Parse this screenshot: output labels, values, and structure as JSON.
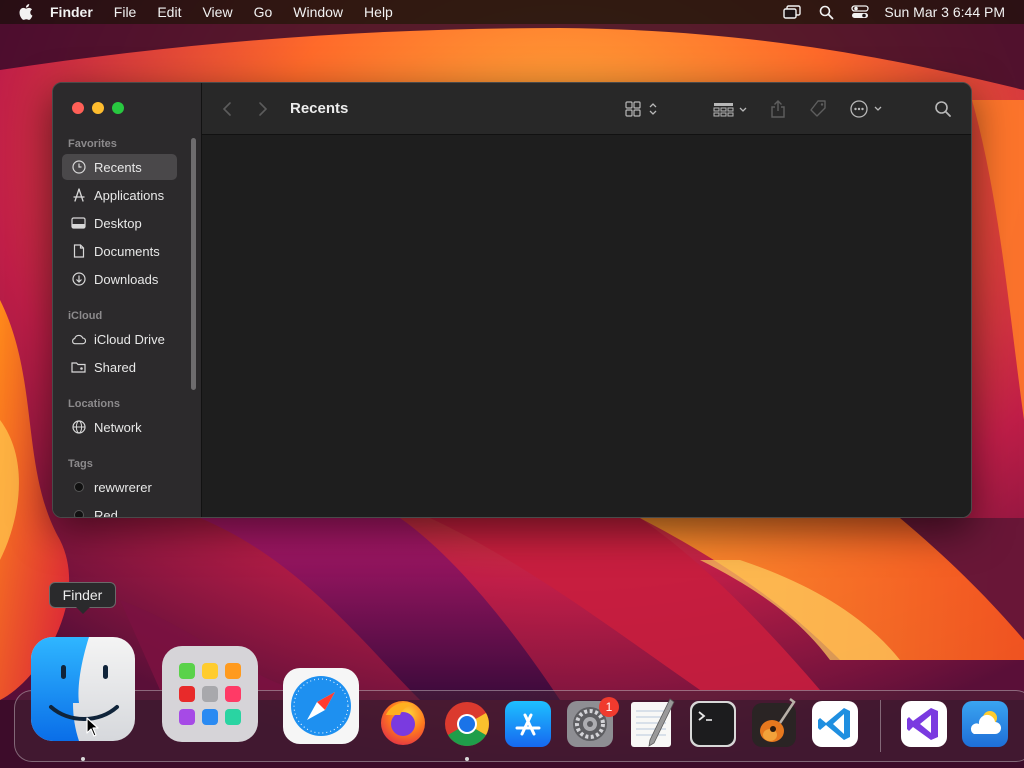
{
  "menubar": {
    "app_name": "Finder",
    "items": [
      "File",
      "Edit",
      "View",
      "Go",
      "Window",
      "Help"
    ],
    "clock": "Sun Mar 3  6:44 PM",
    "icons": [
      "apple-icon",
      "screen-mirroring-icon",
      "spotlight-search-icon",
      "control-center-icon"
    ]
  },
  "finder": {
    "title": "Recents",
    "sidebar": {
      "sections": [
        "Favorites",
        "iCloud",
        "Locations",
        "Tags"
      ],
      "favorites": [
        "Recents",
        "Applications",
        "Desktop",
        "Documents",
        "Downloads"
      ],
      "icloud": [
        "iCloud Drive",
        "Shared"
      ],
      "locations": [
        "Network"
      ],
      "tags": [
        "rewwrerer",
        "Red"
      ]
    },
    "toolbar_icons": [
      "back-icon",
      "forward-icon",
      "view-grid-icon",
      "group-icon",
      "share-icon",
      "tag-icon",
      "more-icon",
      "search-icon"
    ],
    "selected_item": "Recents"
  },
  "tooltip": {
    "text": "Finder"
  },
  "dock": {
    "apps": [
      "Finder",
      "Launchpad",
      "Safari",
      "Firefox",
      "Google Chrome",
      "App Store",
      "System Settings",
      "TextEdit",
      "Terminal",
      "GarageBand",
      "Visual Studio Code",
      "Visual Studio",
      "Weather"
    ],
    "settings_badge": "1",
    "running": [
      "Finder",
      "Google Chrome"
    ]
  },
  "colors": {
    "accent_close": "#ff5f57",
    "accent_minimize": "#febc2e",
    "accent_maximize": "#28c840",
    "badge": "#f03a2e"
  }
}
